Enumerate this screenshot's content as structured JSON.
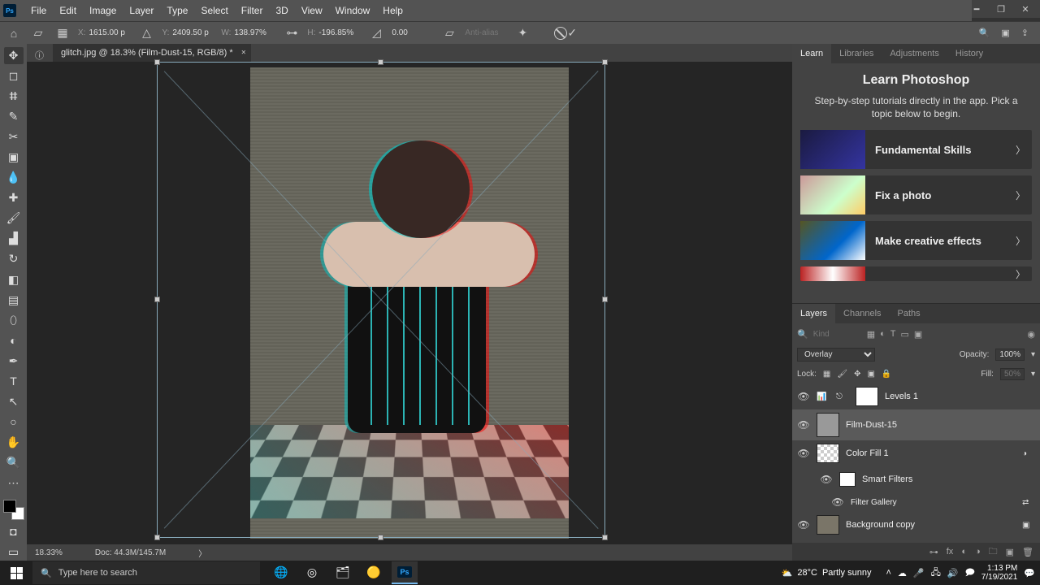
{
  "menubar": {
    "items": [
      "File",
      "Edit",
      "Image",
      "Layer",
      "Type",
      "Select",
      "Filter",
      "3D",
      "View",
      "Window",
      "Help"
    ]
  },
  "options_bar": {
    "x_label": "X:",
    "x": "1615.00 p",
    "y_label": "Y:",
    "y": "2409.50 p",
    "w_label": "W:",
    "w": "138.97%",
    "h_label": "H:",
    "h": "-196.85%",
    "angle_label": "",
    "angle": "0.00",
    "interp": "",
    "antialias": "Anti-alias"
  },
  "document": {
    "tab_title": "glitch.jpg @ 18.3% (Film-Dust-15, RGB/8) *",
    "zoom": "18.33%",
    "docinfo": "Doc: 44.3M/145.7M"
  },
  "right_tabs": {
    "a": "Learn",
    "b": "Libraries",
    "c": "Adjustments",
    "d": "History"
  },
  "learn": {
    "title": "Learn Photoshop",
    "subtitle": "Step-by-step tutorials directly in the app. Pick a topic below to begin.",
    "cards": {
      "c1": "Fundamental Skills",
      "c2": "Fix a photo",
      "c3": "Make creative effects"
    }
  },
  "layers_panel": {
    "tabs": {
      "layers": "Layers",
      "channels": "Channels",
      "paths": "Paths"
    },
    "filter_placeholder": "Kind",
    "blend_mode": "Overlay",
    "opacity_label": "Opacity:",
    "opacity": "100%",
    "lock_label": "Lock:",
    "fill_label": "Fill:",
    "fill": "50%",
    "rows": {
      "levels": "Levels 1",
      "filmdust": "Film-Dust-15",
      "colorfill": "Color Fill 1",
      "smartfilters": "Smart Filters",
      "filtergallery": "Filter Gallery",
      "bgcopy": "Background copy"
    }
  },
  "taskbar": {
    "search_placeholder": "Type here to search",
    "weather_temp": "28°C",
    "weather_desc": "Partly sunny",
    "time": "1:13 PM",
    "date": "7/19/2021"
  }
}
